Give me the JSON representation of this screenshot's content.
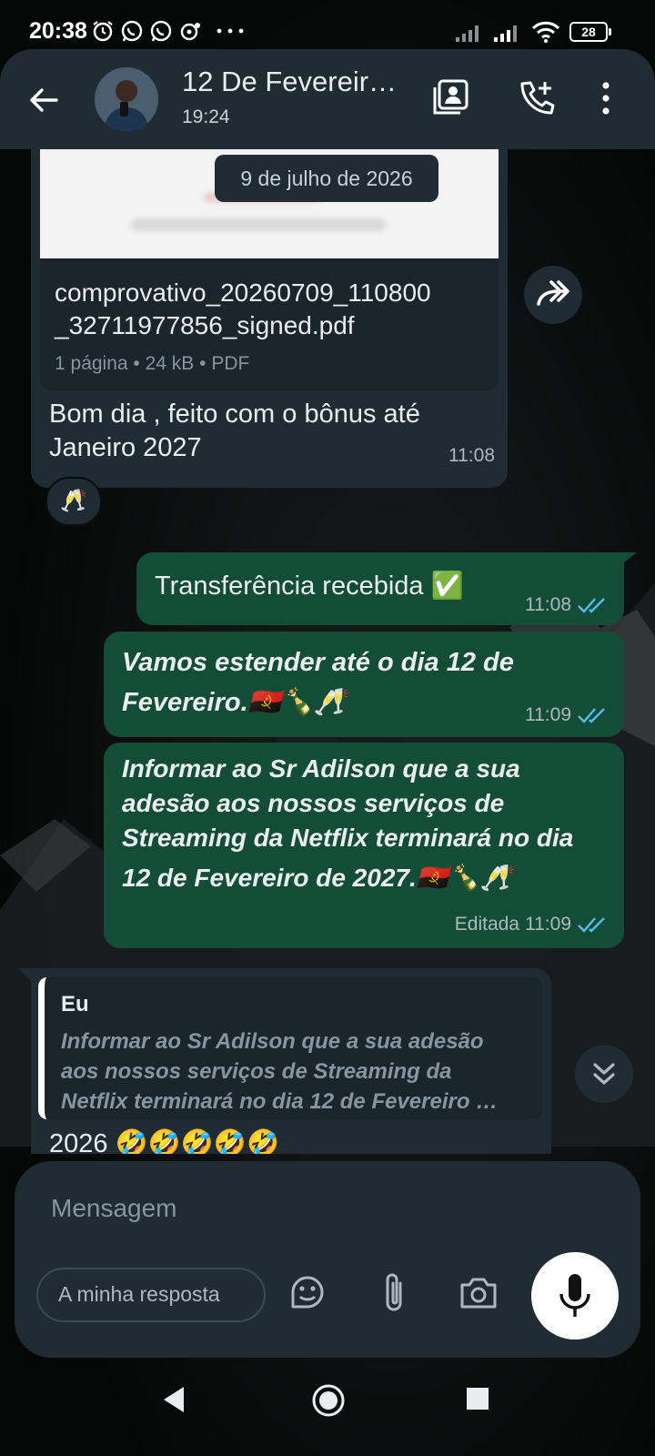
{
  "status_bar": {
    "time": "20:38",
    "battery": "28",
    "left_icons": [
      "alarm-icon",
      "whatsapp-icon",
      "whatsapp-icon",
      "chat-bot-icon",
      "more-dots-icon"
    ],
    "right_icons": [
      "signal-icon",
      "signal-icon",
      "wifi-icon",
      "battery-icon"
    ]
  },
  "header": {
    "title": "12 De Fevereir…",
    "subtitle": "19:24",
    "icons": [
      "back-arrow-icon",
      "contact-card-icon",
      "add-call-icon",
      "overflow-menu-icon"
    ]
  },
  "date_chip": "9 de julho de 2026",
  "document": {
    "filename_line1": "comprovativo_20260709_110800",
    "filename_line2": "_32711977856_signed.pdf",
    "pages": "1 página",
    "size": "24 kB",
    "type": "PDF"
  },
  "incoming_caption": {
    "line1": "Bom dia , feito com o bônus até",
    "line2": "Janeiro 2027",
    "time": "11:08",
    "reaction": "🥂"
  },
  "outgoing": [
    {
      "text": "Transferência recebida ✅",
      "time": "11:08"
    },
    {
      "line1": "Vamos estender até o dia 12 de",
      "line2": "Fevereiro.🇦🇴🍾🥂",
      "time": "11:09"
    },
    {
      "line1": "Informar ao Sr Adilson que a sua",
      "line2": "adesão aos nossos serviços de",
      "line3": "Streaming da Netflix terminará no dia",
      "line4": "12 de Fevereiro de 2027.🇦🇴🍾🥂",
      "edited": "Editada",
      "time": "11:09"
    }
  ],
  "reply": {
    "author": "Eu",
    "quote_line1": "Informar ao Sr Adilson que a sua adesão",
    "quote_line2": "aos nossos serviços de Streaming da",
    "quote_line3": "Netflix terminará no dia 12 de Fevereiro …",
    "text_partial": "2026 🤣🤣🤣🤣🤣"
  },
  "composer": {
    "placeholder": "Mensagem",
    "quick_reply": "A minha resposta",
    "icons": [
      "sticker-icon",
      "attach-icon",
      "camera-icon",
      "mic-icon"
    ]
  },
  "colors": {
    "header_bg": "#1f2c34",
    "incoming_bg": "#1f2c34",
    "outgoing_bg": "#144d37",
    "tick_blue": "#53bdeb"
  }
}
